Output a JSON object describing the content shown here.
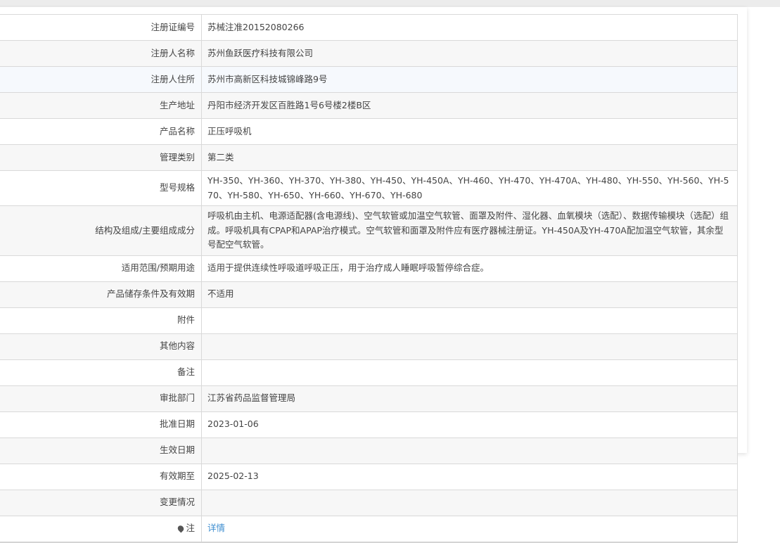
{
  "rows": [
    {
      "label": "注册证编号",
      "value": "苏械注准20152080266"
    },
    {
      "label": "注册人名称",
      "value": "苏州鱼跃医疗科技有限公司"
    },
    {
      "label": "注册人住所",
      "value": "苏州市高新区科技城锦峰路9号"
    },
    {
      "label": "生产地址",
      "value": "丹阳市经济开发区百胜路1号6号楼2楼B区"
    },
    {
      "label": "产品名称",
      "value": "正压呼吸机"
    },
    {
      "label": "管理类别",
      "value": "第二类"
    },
    {
      "label": "型号规格",
      "value": "YH-350、YH-360、YH-370、YH-380、YH-450、YH-450A、YH-460、YH-470、YH-470A、YH-480、YH-550、YH-560、YH-570、YH-580、YH-650、YH-660、YH-670、YH-680"
    },
    {
      "label": "结构及组成/主要组成成分",
      "value": "呼吸机由主机、电源适配器(含电源线)、空气软管或加温空气软管、面罩及附件、湿化器、血氧模块（选配）、数据传输模块（选配）组成。呼吸机具有CPAP和APAP治疗模式。空气软管和面罩及附件应有医疗器械注册证。YH-450A及YH-470A配加温空气软管，其余型号配空气软管。"
    },
    {
      "label": "适用范围/预期用途",
      "value": "适用于提供连续性呼吸道呼吸正压，用于治疗成人睡眠呼吸暂停综合症。"
    },
    {
      "label": "产品储存条件及有效期",
      "value": "不适用"
    },
    {
      "label": "附件",
      "value": ""
    },
    {
      "label": "其他内容",
      "value": ""
    },
    {
      "label": "备注",
      "value": ""
    },
    {
      "label": "审批部门",
      "value": "江苏省药品监督管理局"
    },
    {
      "label": "批准日期",
      "value": "2023-01-06"
    },
    {
      "label": "生效日期",
      "value": ""
    },
    {
      "label": "有效期至",
      "value": "2025-02-13"
    },
    {
      "label": "变更情况",
      "value": ""
    }
  ],
  "note": {
    "label": "注",
    "link": "详情",
    "link_color": "#3e8ed0"
  }
}
